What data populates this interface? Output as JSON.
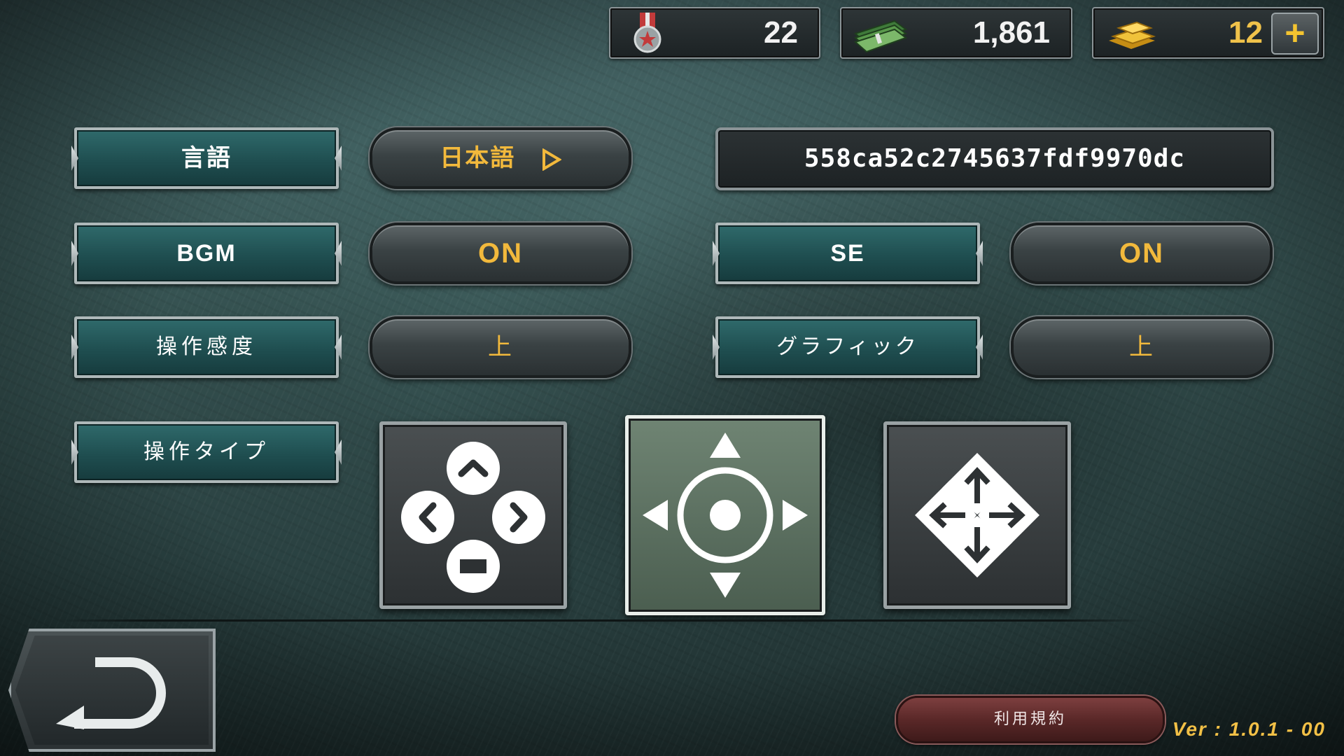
{
  "currencies": {
    "medals": "22",
    "cash": "1,861",
    "gold": "12",
    "add_label": "+"
  },
  "settings": {
    "language": {
      "label": "言語",
      "value": "日本語"
    },
    "user_id": "558ca52c2745637fdf9970dc",
    "bgm": {
      "label": "BGM",
      "value": "ON"
    },
    "se": {
      "label": "SE",
      "value": "ON"
    },
    "sensitivity": {
      "label": "操作感度",
      "value": "上"
    },
    "graphics": {
      "label": "グラフィック",
      "value": "上"
    },
    "control_type": {
      "label": "操作タイプ",
      "options": [
        "dpad-buttons-icon",
        "virtual-joystick-icon",
        "arrow-diamond-icon"
      ],
      "selected": 1
    }
  },
  "footer": {
    "terms_label": "利用規約",
    "version": "Ver : 1.0.1 - 00"
  },
  "colors": {
    "accent_gold": "#f2b93c",
    "label_teal": "#1f4e50",
    "terms_red": "#5a2828"
  }
}
